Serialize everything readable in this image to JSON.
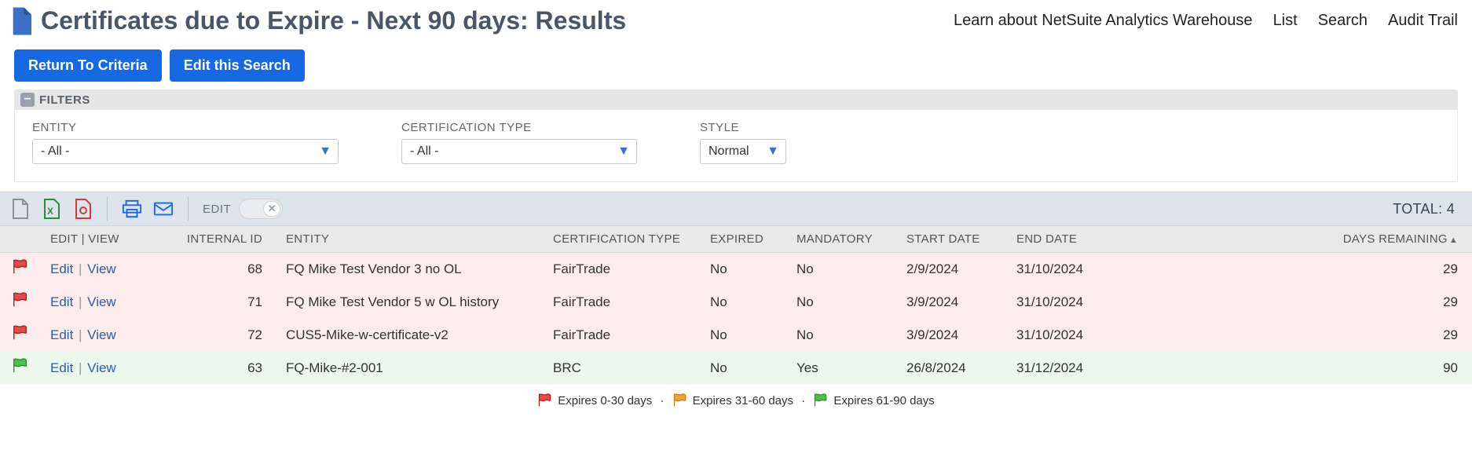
{
  "header": {
    "title": "Certificates due to Expire - Next 90 days: Results",
    "links": [
      "Learn about NetSuite Analytics Warehouse",
      "List",
      "Search",
      "Audit Trail"
    ]
  },
  "buttons": {
    "return": "Return To Criteria",
    "edit_search": "Edit this Search"
  },
  "filters": {
    "heading": "FILTERS",
    "entity": {
      "label": "ENTITY",
      "value": "- All -"
    },
    "cert_type": {
      "label": "CERTIFICATION TYPE",
      "value": "- All -"
    },
    "style": {
      "label": "STYLE",
      "value": "Normal"
    }
  },
  "toolbar": {
    "edit_label": "EDIT",
    "total_label": "TOTAL:",
    "total_value": "4"
  },
  "columns": {
    "edit_view": "EDIT | VIEW",
    "internal_id": "INTERNAL ID",
    "entity": "ENTITY",
    "cert_type": "CERTIFICATION TYPE",
    "expired": "EXPIRED",
    "mandatory": "MANDATORY",
    "start": "START DATE",
    "end": "END DATE",
    "days": "DAYS REMAINING"
  },
  "row_actions": {
    "edit": "Edit",
    "view": "View"
  },
  "rows": [
    {
      "flag": "red",
      "id": "68",
      "entity": "FQ Mike Test Vendor 3 no OL",
      "cert": "FairTrade",
      "expired": "No",
      "mandatory": "No",
      "start": "2/9/2024",
      "end": "31/10/2024",
      "days": "29"
    },
    {
      "flag": "red",
      "id": "71",
      "entity": "FQ Mike Test Vendor 5 w OL history",
      "cert": "FairTrade",
      "expired": "No",
      "mandatory": "No",
      "start": "3/9/2024",
      "end": "31/10/2024",
      "days": "29"
    },
    {
      "flag": "red",
      "id": "72",
      "entity": "CUS5-Mike-w-certificate-v2",
      "cert": "FairTrade",
      "expired": "No",
      "mandatory": "No",
      "start": "3/9/2024",
      "end": "31/10/2024",
      "days": "29"
    },
    {
      "flag": "green",
      "id": "63",
      "entity": "FQ-Mike-#2-001",
      "cert": "BRC",
      "expired": "No",
      "mandatory": "Yes",
      "start": "26/8/2024",
      "end": "31/12/2024",
      "days": "90"
    }
  ],
  "legend": {
    "t1": "Expires 0-30 days",
    "t2": "Expires 31-60 days",
    "t3": "Expires 61-90 days"
  }
}
